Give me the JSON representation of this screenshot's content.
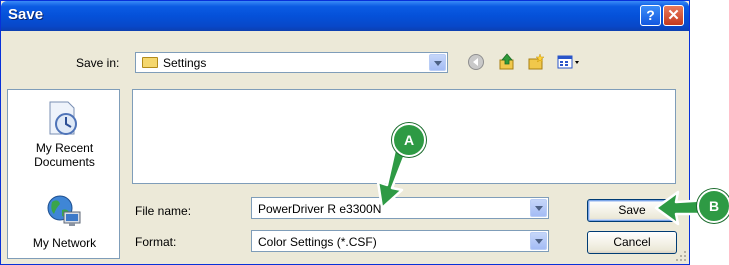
{
  "window": {
    "title": "Save",
    "help_glyph": "?",
    "close_glyph": "✕"
  },
  "save_in": {
    "label": "Save in:",
    "value": "Settings"
  },
  "toolbar": {
    "icons": [
      "back-icon",
      "up-folder-icon",
      "new-folder-icon",
      "views-menu-icon"
    ]
  },
  "places": [
    {
      "label": "My Recent Documents",
      "icon": "recent-documents-icon"
    },
    {
      "label": "My Network",
      "icon": "network-globe-icon"
    }
  ],
  "file_name": {
    "label": "File name:",
    "value": "PowerDriver R e3300N"
  },
  "format": {
    "label": "Format:",
    "value": "Color Settings (*.CSF)"
  },
  "buttons": {
    "save": "Save",
    "cancel": "Cancel"
  },
  "callouts": {
    "a": "A",
    "b": "B"
  },
  "colors": {
    "title_bar": "#0551d9",
    "callout_green": "#2e9a44",
    "dialog_bg": "#ece9d8"
  }
}
